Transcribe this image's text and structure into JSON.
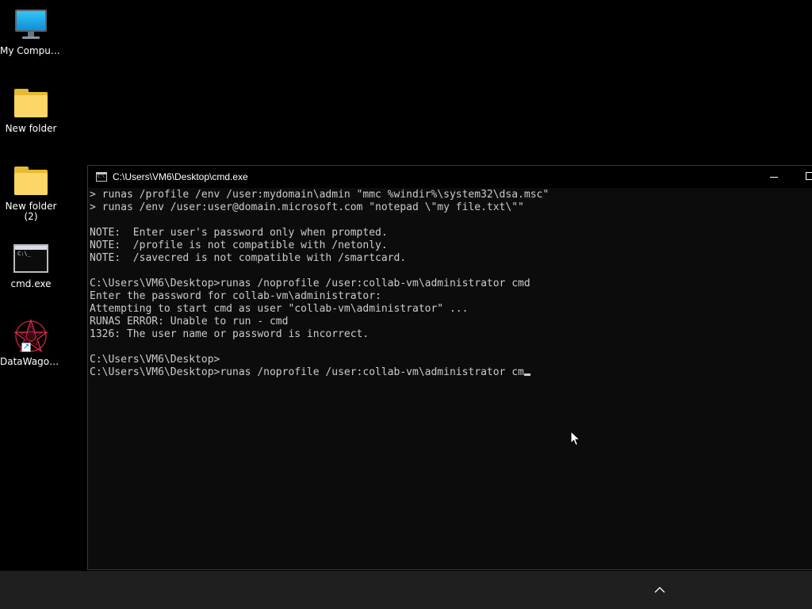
{
  "desktop": {
    "icons": [
      {
        "label": "My Computer",
        "icon": "monitor-icon"
      },
      {
        "label": "New folder",
        "icon": "folder-icon"
      },
      {
        "label": "New folder\n(2)",
        "label_line1": "New folder",
        "label_line2": "(2)",
        "icon": "folder-icon"
      },
      {
        "label": "cmd.exe",
        "icon": "cmd-icon"
      },
      {
        "label": "DataWagon...",
        "icon": "datawagon-icon"
      }
    ]
  },
  "console": {
    "title": "C:\\Users\\VM6\\Desktop\\cmd.exe",
    "title_icon_text": "C:\\",
    "colors": {
      "background": "#0c0c0c",
      "text": "#cccccc",
      "titlebar": "#000000"
    },
    "lines": [
      "> runas /profile /env /user:mydomain\\admin \"mmc %windir%\\system32\\dsa.msc\"",
      "> runas /env /user:user@domain.microsoft.com \"notepad \\\"my file.txt\\\"\"",
      "",
      "NOTE:  Enter user's password only when prompted.",
      "NOTE:  /profile is not compatible with /netonly.",
      "NOTE:  /savecred is not compatible with /smartcard.",
      "",
      "C:\\Users\\VM6\\Desktop>runas /noprofile /user:collab-vm\\administrator cmd",
      "Enter the password for collab-vm\\administrator:",
      "Attempting to start cmd as user \"collab-vm\\administrator\" ...",
      "RUNAS ERROR: Unable to run - cmd",
      "1326: The user name or password is incorrect.",
      "",
      "C:\\Users\\VM6\\Desktop>"
    ],
    "current_input_line": "C:\\Users\\VM6\\Desktop>runas /noprofile /user:collab-vm\\administrator cm"
  },
  "taskbar": {
    "background": "#1f1f1f",
    "tray_icon": "chevron-up-icon"
  }
}
